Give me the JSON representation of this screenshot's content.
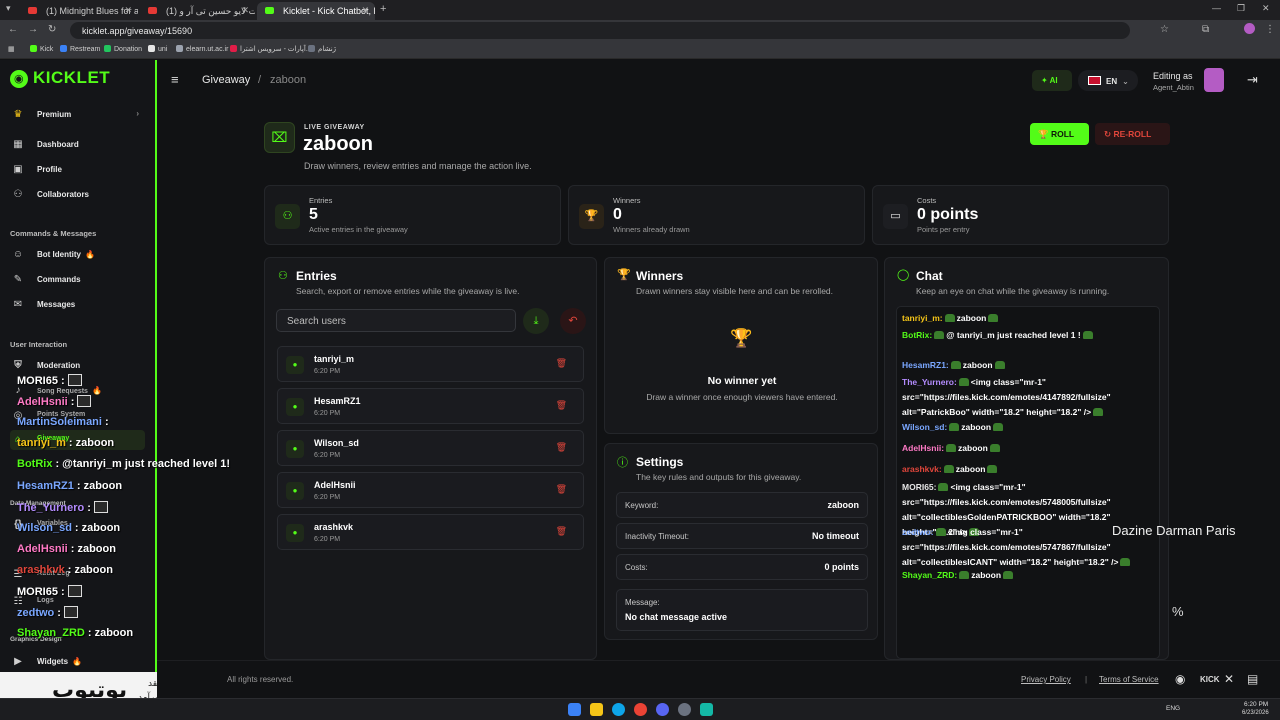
{
  "browser": {
    "tabs": [
      {
        "title": "(1) Midnight Blues for a Br...",
        "color": "#e53935"
      },
      {
        "title": "(1) از کنسرت لایو حسین تی آر و...",
        "color": "#e53935"
      },
      {
        "title": "Kicklet - Kick Chatbot, Kick Wi...",
        "color": "#53fc18"
      }
    ],
    "url": "kicklet.app/giveaway/15690",
    "bookmarks": [
      "Kick",
      "Restream",
      "Donation",
      "uni",
      "elearn.ut.ac.ir",
      "آپارات - سرویس اشترا...",
      "ژنشام"
    ]
  },
  "sidebar": {
    "logo": "KICKLET",
    "premium": "Premium",
    "items_top": [
      "Dashboard",
      "Profile",
      "Collaborators"
    ],
    "section_commands": "Commands & Messages",
    "items_commands": [
      "Bot Identity",
      "Commands",
      "Messages"
    ],
    "section_user": "User Interaction",
    "items_user": [
      "Moderation",
      "Song Requests",
      "Points System",
      "Giveaway"
    ],
    "section_data": "Data Management",
    "items_data": [
      "Variables",
      "Audit Log",
      "Logs"
    ],
    "section_graphics": "Graphics Design",
    "items_graphics": [
      "Widgets"
    ]
  },
  "header": {
    "breadcrumb_root": "Giveaway",
    "breadcrumb_sep": "/",
    "breadcrumb_current": "zaboon",
    "ai_label": "AI",
    "lang_label": "EN",
    "editing_as": "Editing as",
    "editing_user": "Agent_Abtin"
  },
  "giveaway": {
    "kicker": "LIVE GIVEAWAY",
    "title": "zaboon",
    "subtitle": "Draw winners, review entries and manage the action live.",
    "roll_label": "ROLL",
    "reroll_label": "RE-ROLL"
  },
  "stats": [
    {
      "label": "Entries",
      "value": "5",
      "sub": "Active entries in the giveaway"
    },
    {
      "label": "Winners",
      "value": "0",
      "sub": "Winners already drawn"
    },
    {
      "label": "Costs",
      "value": "0 points",
      "sub": "Points per entry"
    }
  ],
  "entries_panel": {
    "title": "Entries",
    "subtitle": "Search, export or remove entries while the giveaway is live.",
    "search_placeholder": "Search users",
    "rows": [
      {
        "name": "tanriyi_m",
        "time": "6:20 PM"
      },
      {
        "name": "HesamRZ1",
        "time": "6:20 PM"
      },
      {
        "name": "Wilson_sd",
        "time": "6:20 PM"
      },
      {
        "name": "AdelHsnii",
        "time": "6:20 PM"
      },
      {
        "name": "arashkvk",
        "time": "6:20 PM"
      }
    ]
  },
  "winners_panel": {
    "title": "Winners",
    "subtitle": "Drawn winners stay visible here and can be rerolled.",
    "empty_title": "No winner yet",
    "empty_sub": "Draw a winner once enough viewers have entered."
  },
  "settings_panel": {
    "title": "Settings",
    "subtitle": "The key rules and outputs for this giveaway.",
    "rows": [
      {
        "key": "Keyword:",
        "value": "zaboon"
      },
      {
        "key": "Inactivity Timeout:",
        "value": "No timeout"
      },
      {
        "key": "Costs:",
        "value": "0 points"
      }
    ],
    "message_key": "Message:",
    "message_value": "No chat message active"
  },
  "chat_panel": {
    "title": "Chat",
    "subtitle": "Keep an eye on chat while the giveaway is running.",
    "lines": [
      {
        "user": "tanriyi_m:",
        "color": "#f5c518",
        "text": "zaboon"
      },
      {
        "user": "BotRix:",
        "color": "#53fc18",
        "text": "@ tanriyi_m just reached level 1 !"
      },
      {
        "user": "HesamRZ1:",
        "color": "#7aa7ff",
        "text": "zaboon"
      },
      {
        "user": "The_Yurnero:",
        "color": "#b48cff",
        "text": "<img class=\"mr-1\" src=\"https://files.kick.com/emotes/4147892/fullsize\" alt=\"PatrickBoo\" width=\"18.2\" height=\"18.2\" />"
      },
      {
        "user": "Wilson_sd:",
        "color": "#7aa7ff",
        "text": "zaboon"
      },
      {
        "user": "AdelHsnii:",
        "color": "#ff7ac6",
        "text": "zaboon"
      },
      {
        "user": "arashkvk:",
        "color": "#e0463b",
        "text": "zaboon"
      },
      {
        "user": "MORI65:",
        "color": "#e6e6e6",
        "text": "<img class=\"mr-1\" src=\"https://files.kick.com/emotes/5748005/fullsize\" alt=\"collectiblesGoldenPATRICKBOO\" width=\"18.2\" height=\"18.2\" />"
      },
      {
        "user": "zedtwo:",
        "color": "#7aa7ff",
        "text": "<img class=\"mr-1\" src=\"https://files.kick.com/emotes/5747867/fullsize\" alt=\"collectiblesICANT\" width=\"18.2\" height=\"18.2\" />"
      },
      {
        "user": "Shayan_ZRD:",
        "color": "#53fc18",
        "text": "zaboon"
      }
    ]
  },
  "overlay": {
    "chat": [
      {
        "user": "MORI65",
        "color": "#ffffff",
        "text": ":",
        "img": true
      },
      {
        "user": "AdelHsnii",
        "color": "#ff7ac6",
        "text": ":",
        "img": true
      },
      {
        "user": "MartinSoleimani",
        "color": "#7aa7ff",
        "text": ":",
        "img": false
      },
      {
        "user": "tanriyi_m",
        "color": "#f5c518",
        "text": ": zaboon",
        "img": false
      },
      {
        "user": "BotRix",
        "color": "#53fc18",
        "text": ": @tanriyi_m just reached level 1!",
        "img": false
      },
      {
        "user": "HesamRZ1",
        "color": "#7aa7ff",
        "text": ": zaboon",
        "img": false
      },
      {
        "user": "The_Yurnero",
        "color": "#b48cff",
        "text": ":",
        "img": true
      },
      {
        "user": "Wilson_sd",
        "color": "#7aa7ff",
        "text": ": zaboon",
        "img": false
      },
      {
        "user": "AdelHsnii",
        "color": "#ff7ac6",
        "text": ": zaboon",
        "img": false
      },
      {
        "user": "arashkvk",
        "color": "#e0463b",
        "text": ": zaboon",
        "img": false
      },
      {
        "user": "MORI65",
        "color": "#ffffff",
        "text": ":",
        "img": true
      },
      {
        "user": "zedtwo",
        "color": "#7aa7ff",
        "text": ":",
        "img": true
      },
      {
        "user": "Shayan_ZRD",
        "color": "#53fc18",
        "text": ": zaboon",
        "img": false
      }
    ],
    "ad_text": "Dazine Darman Paris",
    "percent": "%",
    "yt_text": "یوتیوب",
    "yt_sub1": "نقد",
    "yt_sub2": "برآمد"
  },
  "footer": {
    "rights": "All rights reserved.",
    "privacy": "Privacy Policy",
    "sep": "|",
    "terms": "Terms of Service",
    "kick": "KICK"
  },
  "taskbar": {
    "lang": "ENG",
    "time": "6:20 PM",
    "date": "6/23/2026"
  },
  "colors": {
    "accent": "#53fc18",
    "danger": "#e0463b"
  }
}
